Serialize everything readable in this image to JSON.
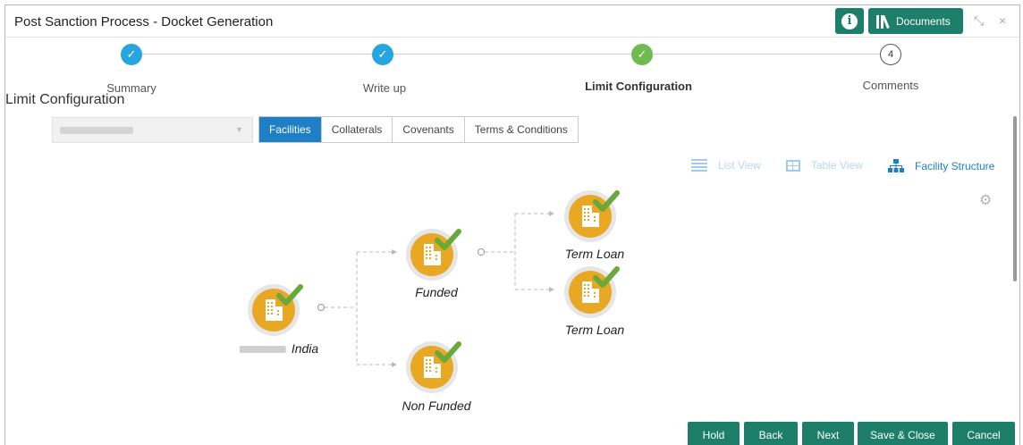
{
  "window": {
    "title": "Post Sanction Process - Docket Generation",
    "documents_label": "Documents",
    "info_icon": "info-icon",
    "minimize_glyph": "⤡",
    "close_glyph": "×"
  },
  "steps": [
    {
      "label": "Summary",
      "state": "done",
      "mark": "✓"
    },
    {
      "label": "Write up",
      "state": "done",
      "mark": "✓"
    },
    {
      "label": "Limit Configuration",
      "state": "current",
      "mark": "✓"
    },
    {
      "label": "Comments",
      "state": "pending",
      "mark": "4"
    }
  ],
  "section_title": "Limit Configuration",
  "tabs": [
    {
      "label": "Facilities",
      "active": true
    },
    {
      "label": "Collaterals",
      "active": false
    },
    {
      "label": "Covenants",
      "active": false
    },
    {
      "label": "Terms & Conditions",
      "active": false
    }
  ],
  "views": {
    "list": "List View",
    "table": "Table View",
    "structure": "Facility Structure"
  },
  "tree": {
    "root": {
      "label": "India"
    },
    "funded": {
      "label": "Funded"
    },
    "non_funded": {
      "label": "Non Funded"
    },
    "term_loan_1": {
      "label": "Term Loan"
    },
    "term_loan_2": {
      "label": "Term Loan"
    }
  },
  "buttons": {
    "hold": "Hold",
    "back": "Back",
    "next": "Next",
    "save_close": "Save & Close",
    "cancel": "Cancel"
  },
  "colors": {
    "primary": "#1d7f6a",
    "step_done": "#27a5df",
    "step_current": "#6fbb4f",
    "tab_active": "#1d7fc6",
    "node_fill": "#e8a824",
    "check": "#6aa83a"
  }
}
